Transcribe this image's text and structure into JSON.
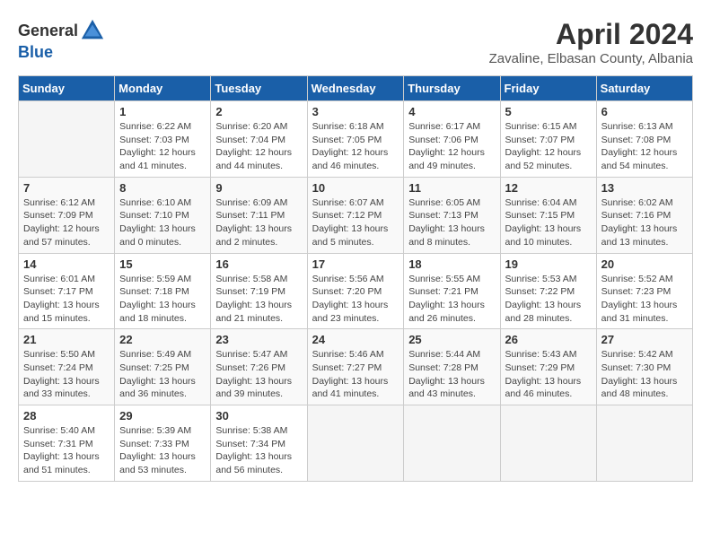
{
  "header": {
    "logo": {
      "general": "General",
      "blue": "Blue"
    },
    "title": "April 2024",
    "location": "Zavaline, Elbasan County, Albania"
  },
  "calendar": {
    "weekdays": [
      "Sunday",
      "Monday",
      "Tuesday",
      "Wednesday",
      "Thursday",
      "Friday",
      "Saturday"
    ],
    "weeks": [
      [
        {
          "day": null
        },
        {
          "day": 1,
          "sunrise": "6:22 AM",
          "sunset": "7:03 PM",
          "daylight": "12 hours and 41 minutes."
        },
        {
          "day": 2,
          "sunrise": "6:20 AM",
          "sunset": "7:04 PM",
          "daylight": "12 hours and 44 minutes."
        },
        {
          "day": 3,
          "sunrise": "6:18 AM",
          "sunset": "7:05 PM",
          "daylight": "12 hours and 46 minutes."
        },
        {
          "day": 4,
          "sunrise": "6:17 AM",
          "sunset": "7:06 PM",
          "daylight": "12 hours and 49 minutes."
        },
        {
          "day": 5,
          "sunrise": "6:15 AM",
          "sunset": "7:07 PM",
          "daylight": "12 hours and 52 minutes."
        },
        {
          "day": 6,
          "sunrise": "6:13 AM",
          "sunset": "7:08 PM",
          "daylight": "12 hours and 54 minutes."
        }
      ],
      [
        {
          "day": 7,
          "sunrise": "6:12 AM",
          "sunset": "7:09 PM",
          "daylight": "12 hours and 57 minutes."
        },
        {
          "day": 8,
          "sunrise": "6:10 AM",
          "sunset": "7:10 PM",
          "daylight": "13 hours and 0 minutes."
        },
        {
          "day": 9,
          "sunrise": "6:09 AM",
          "sunset": "7:11 PM",
          "daylight": "13 hours and 2 minutes."
        },
        {
          "day": 10,
          "sunrise": "6:07 AM",
          "sunset": "7:12 PM",
          "daylight": "13 hours and 5 minutes."
        },
        {
          "day": 11,
          "sunrise": "6:05 AM",
          "sunset": "7:13 PM",
          "daylight": "13 hours and 8 minutes."
        },
        {
          "day": 12,
          "sunrise": "6:04 AM",
          "sunset": "7:15 PM",
          "daylight": "13 hours and 10 minutes."
        },
        {
          "day": 13,
          "sunrise": "6:02 AM",
          "sunset": "7:16 PM",
          "daylight": "13 hours and 13 minutes."
        }
      ],
      [
        {
          "day": 14,
          "sunrise": "6:01 AM",
          "sunset": "7:17 PM",
          "daylight": "13 hours and 15 minutes."
        },
        {
          "day": 15,
          "sunrise": "5:59 AM",
          "sunset": "7:18 PM",
          "daylight": "13 hours and 18 minutes."
        },
        {
          "day": 16,
          "sunrise": "5:58 AM",
          "sunset": "7:19 PM",
          "daylight": "13 hours and 21 minutes."
        },
        {
          "day": 17,
          "sunrise": "5:56 AM",
          "sunset": "7:20 PM",
          "daylight": "13 hours and 23 minutes."
        },
        {
          "day": 18,
          "sunrise": "5:55 AM",
          "sunset": "7:21 PM",
          "daylight": "13 hours and 26 minutes."
        },
        {
          "day": 19,
          "sunrise": "5:53 AM",
          "sunset": "7:22 PM",
          "daylight": "13 hours and 28 minutes."
        },
        {
          "day": 20,
          "sunrise": "5:52 AM",
          "sunset": "7:23 PM",
          "daylight": "13 hours and 31 minutes."
        }
      ],
      [
        {
          "day": 21,
          "sunrise": "5:50 AM",
          "sunset": "7:24 PM",
          "daylight": "13 hours and 33 minutes."
        },
        {
          "day": 22,
          "sunrise": "5:49 AM",
          "sunset": "7:25 PM",
          "daylight": "13 hours and 36 minutes."
        },
        {
          "day": 23,
          "sunrise": "5:47 AM",
          "sunset": "7:26 PM",
          "daylight": "13 hours and 39 minutes."
        },
        {
          "day": 24,
          "sunrise": "5:46 AM",
          "sunset": "7:27 PM",
          "daylight": "13 hours and 41 minutes."
        },
        {
          "day": 25,
          "sunrise": "5:44 AM",
          "sunset": "7:28 PM",
          "daylight": "13 hours and 43 minutes."
        },
        {
          "day": 26,
          "sunrise": "5:43 AM",
          "sunset": "7:29 PM",
          "daylight": "13 hours and 46 minutes."
        },
        {
          "day": 27,
          "sunrise": "5:42 AM",
          "sunset": "7:30 PM",
          "daylight": "13 hours and 48 minutes."
        }
      ],
      [
        {
          "day": 28,
          "sunrise": "5:40 AM",
          "sunset": "7:31 PM",
          "daylight": "13 hours and 51 minutes."
        },
        {
          "day": 29,
          "sunrise": "5:39 AM",
          "sunset": "7:33 PM",
          "daylight": "13 hours and 53 minutes."
        },
        {
          "day": 30,
          "sunrise": "5:38 AM",
          "sunset": "7:34 PM",
          "daylight": "13 hours and 56 minutes."
        },
        {
          "day": null
        },
        {
          "day": null
        },
        {
          "day": null
        },
        {
          "day": null
        }
      ]
    ]
  }
}
